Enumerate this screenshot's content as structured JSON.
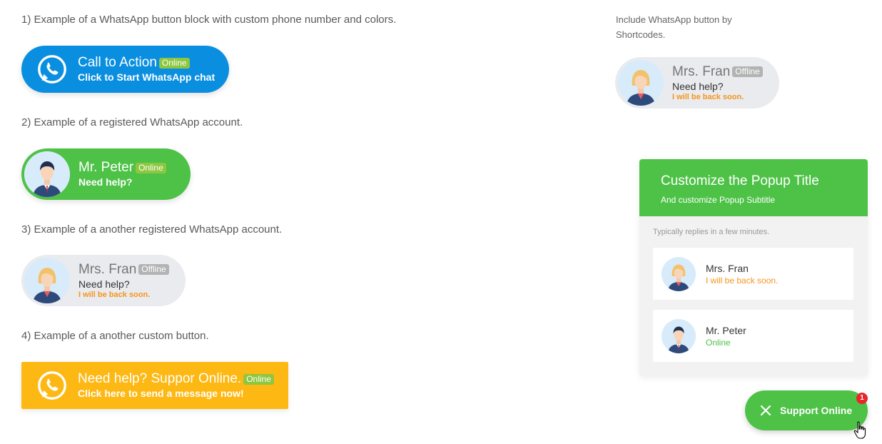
{
  "examples": [
    {
      "caption": "1) Example of a WhatsApp button block with custom phone number and colors.",
      "title": "Call to Action",
      "badge": "Online",
      "subtitle": "Click to Start WhatsApp chat",
      "color": "#0a8fe0"
    },
    {
      "caption": "2) Example of a registered WhatsApp account.",
      "title": "Mr. Peter",
      "badge": "Online",
      "subtitle": "Need help?",
      "color": "#4dc247"
    },
    {
      "caption": "3) Example of a another registered WhatsApp account.",
      "title": "Mrs. Fran",
      "badge": "Offline",
      "subtitle": "Need help?",
      "note": "I will be back soon.",
      "color": "#e9ebee"
    },
    {
      "caption": "4) Example of a another custom button.",
      "title": "Need help? Suppor Online.",
      "badge": "Online",
      "subtitle": "Click here to send a message now!",
      "color": "#fdb813"
    }
  ],
  "shortcode": {
    "note": "Include WhatsApp button by Shortcodes.",
    "title": "Mrs. Fran",
    "badge": "Offline",
    "subtitle": "Need help?",
    "note2": "I will be back soon."
  },
  "popup": {
    "title": "Customize the Popup Title",
    "subtitle": "And customize Popup Subtitle",
    "reply_note": "Typically replies in a few minutes.",
    "agents": [
      {
        "name": "Mrs. Fran",
        "status": "I will be back soon.",
        "status_color": "#f7941d"
      },
      {
        "name": "Mr. Peter",
        "status": "Online",
        "status_color": "#4dc247"
      }
    ]
  },
  "floating": {
    "label": "Support Online",
    "count": "1",
    "close_icon": "close-icon"
  },
  "colors": {
    "whatsapp_green": "#4dc247",
    "online_badge": "#8dc63f",
    "offline_badge": "#b3b3b3",
    "note_orange": "#f7941d"
  }
}
